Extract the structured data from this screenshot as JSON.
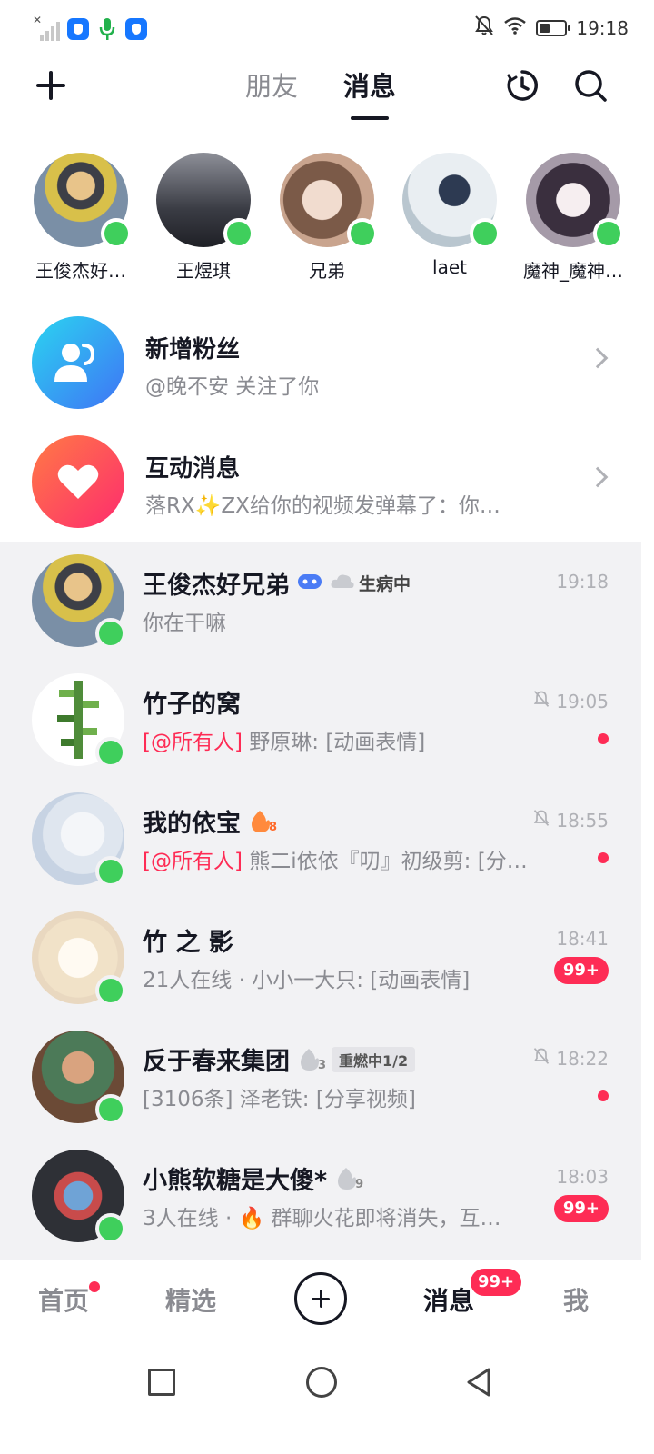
{
  "status_bar": {
    "time": "19:18",
    "icons": [
      "signal-icon",
      "app-icon",
      "mic-icon",
      "app-icon",
      "mute-icon",
      "wifi-icon",
      "battery-icon"
    ]
  },
  "header": {
    "tabs": [
      {
        "label": "朋友",
        "active": false
      },
      {
        "label": "消息",
        "active": true
      }
    ],
    "icons": [
      "plus-icon",
      "refresh-icon",
      "search-icon"
    ]
  },
  "stories": [
    {
      "name": "王俊杰好…",
      "avatar_color": "#7a8fa6"
    },
    {
      "name": "王煜琪",
      "avatar_color": "#4a4d56"
    },
    {
      "name": "兄弟",
      "avatar_color": "#c9a48e"
    },
    {
      "name": "laet",
      "avatar_color": "#b9c6cf"
    },
    {
      "name": "魔神_魔神…",
      "avatar_color": "#a59aa8"
    }
  ],
  "system_rows": [
    {
      "title": "新增粉丝",
      "subtitle": "@晚不安 关注了你",
      "icon": "person-icon",
      "colors": [
        "#2bd4f0",
        "#3f74f5"
      ]
    },
    {
      "title": "互动消息",
      "subtitle": "落RX✨ZX给你的视频发弹幕了：你…",
      "icon": "heart-icon",
      "colors": [
        "#ff7a45",
        "#fe2c6e"
      ]
    }
  ],
  "chats": [
    {
      "title": "王俊杰好兄弟",
      "status_tag": "生病中",
      "subtitle": "你在干嘛",
      "time": "19:18",
      "muted": false,
      "indicator": "none",
      "avatar_color": "#7a8fa6"
    },
    {
      "title": "竹子的窝",
      "at_tag": "[@所有人]",
      "subtitle": " 野原琳: [动画表情]",
      "time": "19:05",
      "muted": true,
      "indicator": "dot",
      "avatar_color": "#ffffff"
    },
    {
      "title": "我的依宝",
      "flame_count": "8",
      "at_tag": "[@所有人]",
      "subtitle": " 熊二i依依『叨』初级剪: [分…",
      "time": "18:55",
      "muted": true,
      "indicator": "dot",
      "avatar_color": "#c7d3e3"
    },
    {
      "title": "竹 之 影",
      "subtitle": "21人在线 · 小小一大只: [动画表情]",
      "time": "18:41",
      "muted": false,
      "indicator": "badge",
      "badge": "99+",
      "avatar_color": "#e9d8c0"
    },
    {
      "title": "反于春来集团",
      "flame_count": "3",
      "tag": "重燃中1/2",
      "subtitle": "[3106条] 泽老铁: [分享视频]",
      "time": "18:22",
      "muted": true,
      "indicator": "dot",
      "avatar_color": "#6b4a36"
    },
    {
      "title": "小熊软糖是大傻*",
      "flame_count": "9",
      "subtitle": "3人在线 · 🔥 群聊火花即将消失，互…",
      "time": "18:03",
      "muted": false,
      "indicator": "badge",
      "badge": "99+",
      "avatar_color": "#2e3036"
    }
  ],
  "bottom_nav": {
    "items": [
      "首页",
      "精选",
      "消息",
      "我"
    ],
    "active": "消息",
    "badge": "99+"
  },
  "colors": {
    "accent": "#fe2c55",
    "online": "#3fcf5c",
    "list_bg": "#f2f2f4"
  }
}
